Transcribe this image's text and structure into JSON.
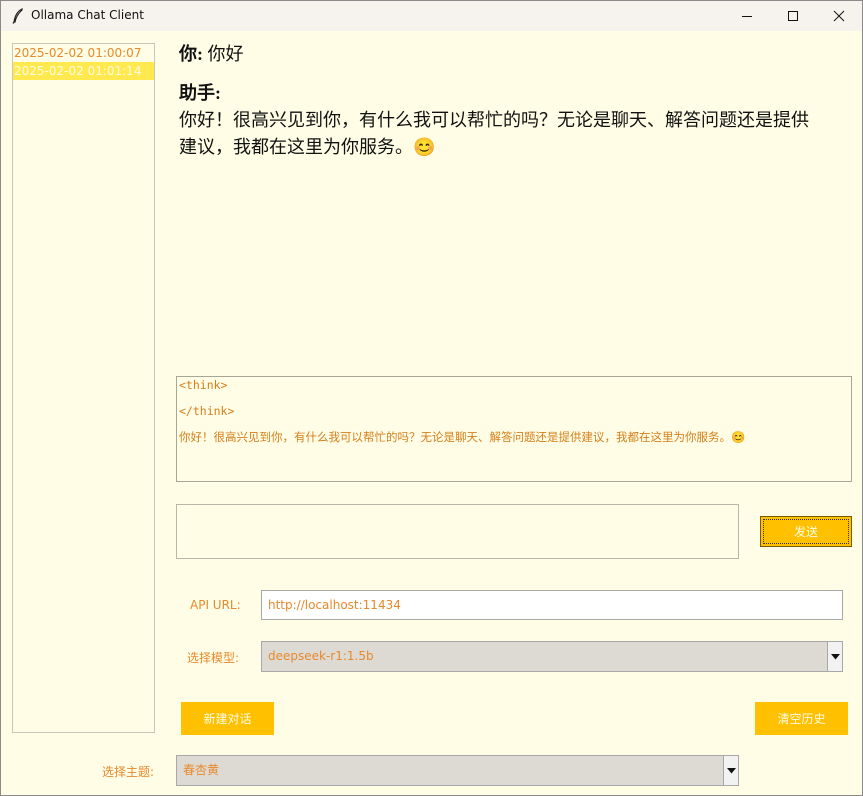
{
  "window": {
    "title": "Ollama Chat Client"
  },
  "history": {
    "items": [
      {
        "label": "2025-02-02 01:00:07",
        "selected": false
      },
      {
        "label": "2025-02-02 01:01:14",
        "selected": true
      }
    ]
  },
  "chat": {
    "messages": [
      {
        "role": "你:",
        "text": "你好"
      },
      {
        "role": "助手:",
        "lines": [
          "你好！很高兴见到你，有什么我可以帮忙的吗？无论是聊天、解答问题还是提供",
          "建议，我都在这里为你服务。😊"
        ]
      }
    ]
  },
  "raw_output": {
    "lines": [
      "<think>",
      "</think>",
      "你好！很高兴见到你，有什么我可以帮忙的吗？无论是聊天、解答问题还是提供建议，我都在这里为你服务。😊"
    ]
  },
  "input": {
    "value": ""
  },
  "send_button": {
    "label": "发送"
  },
  "api": {
    "label": "API URL:",
    "value": "http://localhost:11434"
  },
  "model": {
    "label": "选择模型:",
    "value": "deepseek-r1:1.5b"
  },
  "buttons": {
    "new_chat": "新建对话",
    "clear_history": "清空历史"
  },
  "theme": {
    "label": "选择主题:",
    "value": "春杏黄"
  },
  "icons": {
    "app": "feather-icon",
    "minimize": "minimize-icon",
    "maximize": "maximize-icon",
    "close": "close-icon",
    "dropdown": "chevron-down-icon"
  },
  "colors": {
    "background": "#fffde6",
    "accent": "#ffc000",
    "text_accent": "#e8892c",
    "selection": "#ffe94f"
  }
}
